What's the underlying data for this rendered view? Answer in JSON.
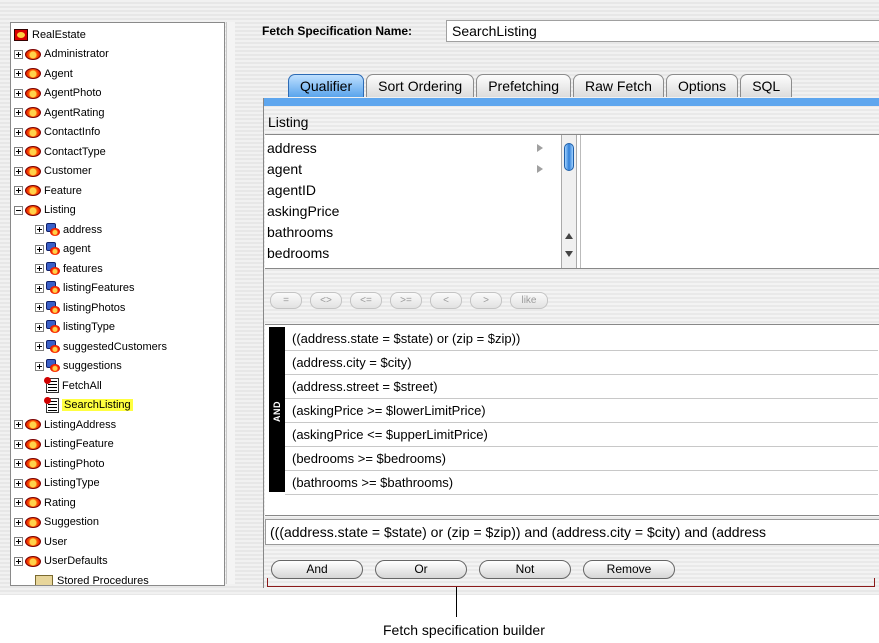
{
  "tree": {
    "root": "RealEstate",
    "entities_before": [
      "Administrator",
      "Agent",
      "AgentPhoto",
      "AgentRating",
      "ContactInfo",
      "ContactType",
      "Customer",
      "Feature"
    ],
    "open_entity": "Listing",
    "relationships": [
      "address",
      "agent",
      "features",
      "listingFeatures",
      "listingPhotos",
      "listingType",
      "suggestedCustomers",
      "suggestions"
    ],
    "fetch_specs": [
      "FetchAll",
      "SearchListing"
    ],
    "selected_fetch_spec": "SearchListing",
    "entities_after": [
      "ListingAddress",
      "ListingFeature",
      "ListingPhoto",
      "ListingType",
      "Rating",
      "Suggestion",
      "User",
      "UserDefaults"
    ],
    "stored_procedures": "Stored Procedures"
  },
  "fetch_spec": {
    "name_label": "Fetch Specification Name:",
    "name_value": "SearchListing"
  },
  "tabs": [
    {
      "label": "Qualifier",
      "active": true
    },
    {
      "label": "Sort Ordering",
      "active": false
    },
    {
      "label": "Prefetching",
      "active": false
    },
    {
      "label": "Raw Fetch",
      "active": false
    },
    {
      "label": "Options",
      "active": false
    },
    {
      "label": "SQL",
      "active": false
    }
  ],
  "browser": {
    "entity": "Listing",
    "attributes": [
      "address",
      "agent",
      "agentID",
      "askingPrice",
      "bathrooms",
      "bedrooms"
    ],
    "attributes_with_arrow": [
      "address",
      "agent"
    ]
  },
  "operators": [
    "=",
    "<>",
    "<=",
    ">=",
    "<",
    ">",
    "like"
  ],
  "qualifier": {
    "conjunction": "AND",
    "rows": [
      "((address.state = $state) or (zip = $zip))",
      "(address.city = $city)",
      "(address.street = $street)",
      "(askingPrice >= $lowerLimitPrice)",
      "(askingPrice <= $upperLimitPrice)",
      "(bedrooms >= $bedrooms)",
      "(bathrooms >= $bathrooms)"
    ],
    "expression": "(((address.state = $state) or (zip = $zip)) and (address.city = $city) and (address"
  },
  "buttons": {
    "and": "And",
    "or": "Or",
    "not": "Not",
    "remove": "Remove"
  },
  "caption": "Fetch specification builder"
}
